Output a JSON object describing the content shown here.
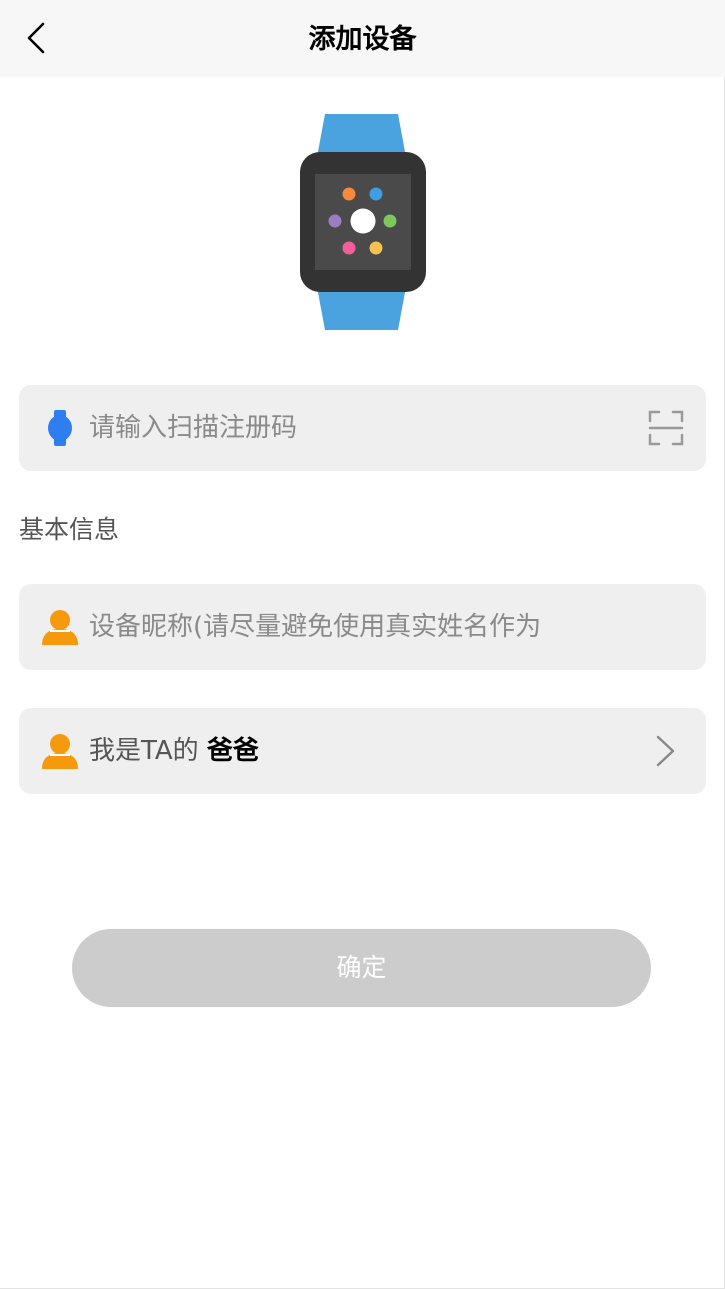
{
  "header": {
    "title": "添加设备",
    "back_icon": "chevron-left-icon"
  },
  "device_image": {
    "icon": "smartwatch-icon",
    "band_color": "#4aa3df",
    "dot_colors": [
      "#f7893a",
      "#3e9ee0",
      "#9a7fc0",
      "#ffffff",
      "#7cc85a",
      "#f05f9a",
      "#f6c350"
    ]
  },
  "register_code": {
    "icon": "watch-icon",
    "icon_color": "#2f7ef0",
    "placeholder": "请输入扫描注册码",
    "value": "",
    "scan_icon": "scan-icon"
  },
  "basic_info": {
    "section_label": "基本信息",
    "nickname": {
      "icon": "person-icon",
      "icon_color": "#f59a0c",
      "placeholder": "设备昵称(请尽量避免使用真实姓名作为",
      "value": ""
    },
    "relation": {
      "icon": "person-icon",
      "prefix": "我是TA的",
      "value": "爸爸",
      "arrow_icon": "chevron-right-icon"
    }
  },
  "confirm_button": {
    "label": "确定",
    "color": "#cccccc"
  }
}
